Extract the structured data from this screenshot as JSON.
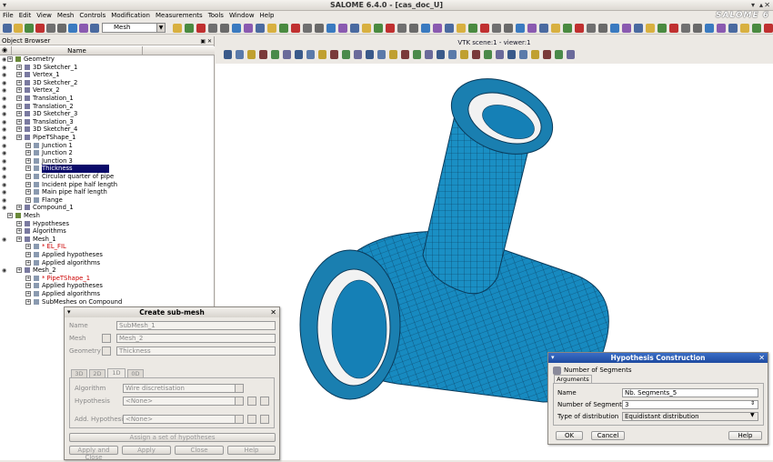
{
  "window": {
    "title": "SALOME 6.4.0 - [cas_doc_U]",
    "brand": "SALOME 6"
  },
  "menu": [
    "File",
    "Edit",
    "View",
    "Mesh",
    "Controls",
    "Modification",
    "Measurements",
    "Tools",
    "Window",
    "Help"
  ],
  "module_combo": {
    "value": "Mesh"
  },
  "object_browser": {
    "title": "Object Browser",
    "column": "Name",
    "rows": [
      {
        "label": "Geometry",
        "level": 0,
        "eye": true
      },
      {
        "label": "3D Sketcher_1",
        "level": 1,
        "eye": true
      },
      {
        "label": "Vertex_1",
        "level": 1,
        "eye": true
      },
      {
        "label": "3D Sketcher_2",
        "level": 1,
        "eye": true
      },
      {
        "label": "Vertex_2",
        "level": 1,
        "eye": true
      },
      {
        "label": "Translation_1",
        "level": 1,
        "eye": true
      },
      {
        "label": "Translation_2",
        "level": 1,
        "eye": true
      },
      {
        "label": "3D Sketcher_3",
        "level": 1,
        "eye": true
      },
      {
        "label": "Translation_3",
        "level": 1,
        "eye": true
      },
      {
        "label": "3D Sketcher_4",
        "level": 1,
        "eye": true
      },
      {
        "label": "PipeTShape_1",
        "level": 1,
        "eye": true
      },
      {
        "label": "Junction 1",
        "level": 2,
        "eye": true
      },
      {
        "label": "Junction 2",
        "level": 2,
        "eye": true
      },
      {
        "label": "Junction 3",
        "level": 2,
        "eye": true
      },
      {
        "label": "Thickness",
        "level": 2,
        "eye": true,
        "selected": true
      },
      {
        "label": "Circular quarter of pipe",
        "level": 2,
        "eye": true
      },
      {
        "label": "Incident pipe half length",
        "level": 2,
        "eye": true
      },
      {
        "label": "Main pipe half length",
        "level": 2,
        "eye": true
      },
      {
        "label": "Flange",
        "level": 2,
        "eye": true
      },
      {
        "label": "Compound_1",
        "level": 1,
        "eye": true
      },
      {
        "label": "Mesh",
        "level": 0,
        "eye": false
      },
      {
        "label": "Hypotheses",
        "level": 1,
        "eye": false
      },
      {
        "label": "Algorithms",
        "level": 1,
        "eye": false
      },
      {
        "label": "Mesh_1",
        "level": 1,
        "eye": true
      },
      {
        "label": "* EL_FIL",
        "level": 2,
        "eye": false,
        "red": true
      },
      {
        "label": "Applied hypotheses",
        "level": 2,
        "eye": false
      },
      {
        "label": "Applied algorithms",
        "level": 2,
        "eye": false
      },
      {
        "label": "Mesh_2",
        "level": 1,
        "eye": true
      },
      {
        "label": "* PipeTShape_1",
        "level": 2,
        "eye": false,
        "red": true
      },
      {
        "label": "Applied hypotheses",
        "level": 2,
        "eye": false
      },
      {
        "label": "Applied algorithms",
        "level": 2,
        "eye": false
      },
      {
        "label": "SubMeshes on Compound",
        "level": 2,
        "eye": false
      }
    ]
  },
  "viewer": {
    "title": "VTK scene:1 - viewer:1",
    "mesh_color": "#1a8fc4",
    "edge_color": "#0a3a5a"
  },
  "create_submesh": {
    "title": "Create sub-mesh",
    "name_label": "Name",
    "name_value": "SubMesh_1",
    "mesh_label": "Mesh",
    "mesh_value": "Mesh_2",
    "geometry_label": "Geometry",
    "geometry_value": "Thickness",
    "tabs": [
      "3D",
      "2D",
      "1D",
      "0D"
    ],
    "algorithm_label": "Algorithm",
    "algorithm_value": "Wire discretisation",
    "hypothesis_label": "Hypothesis",
    "hypothesis_value": "<None>",
    "add_hypothesis_label": "Add. Hypothesis",
    "add_hypothesis_value": "<None>",
    "assign_button": "Assign a set of hypotheses",
    "apply_close": "Apply and Close",
    "apply": "Apply",
    "close": "Close",
    "help": "Help"
  },
  "hypothesis": {
    "title": "Hypothesis Construction",
    "subtitle": "Number of Segments",
    "tab": "Arguments",
    "name_label": "Name",
    "name_value": "Nb. Segments_5",
    "segments_label": "Number of Segments",
    "segments_value": "3",
    "distribution_label": "Type of distribution",
    "distribution_value": "Equidistant distribution",
    "ok": "OK",
    "cancel": "Cancel",
    "help": "Help"
  }
}
